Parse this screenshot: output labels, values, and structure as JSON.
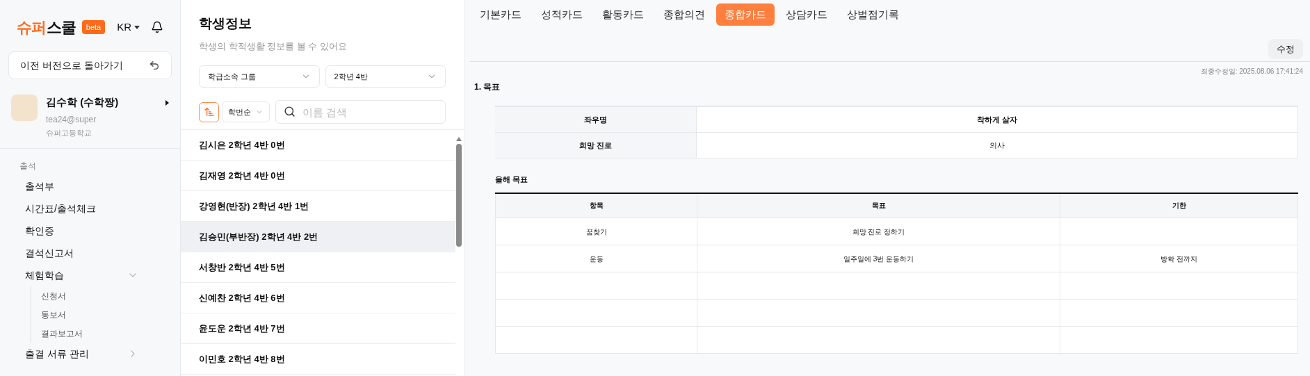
{
  "sidebar": {
    "logo": "슈퍼스쿨",
    "badge": "beta",
    "language": "KR",
    "back_button": "이전 버전으로 돌아가기",
    "profile": {
      "name": "김수학 (수학짱)",
      "email": "tea24@super",
      "school": "슈퍼고등학교"
    },
    "section": "출석",
    "items": [
      {
        "label": "출석부"
      },
      {
        "label": "시간표/출석체크"
      },
      {
        "label": "확인증"
      },
      {
        "label": "결석신고서"
      },
      {
        "label": "체험학습",
        "expanded": true,
        "children": [
          {
            "label": "신청서"
          },
          {
            "label": "통보서"
          },
          {
            "label": "결과보고서"
          }
        ]
      },
      {
        "label": "출결 서류 관리",
        "expanded": false
      }
    ]
  },
  "student_panel": {
    "title": "학생정보",
    "subtitle": "학생의 학적생활 정보를 볼 수 있어요",
    "group_select": "학급소속 그룹",
    "class_select": "2학년 4반",
    "sort_select": "학번순",
    "search": {
      "placeholder": "이름 검색"
    },
    "students": [
      {
        "label": "김시은 2학년 4반 0번",
        "selected": false
      },
      {
        "label": "김재영 2학년 4반 0번",
        "selected": false
      },
      {
        "label": "강영현(반장) 2학년 4반 1번",
        "selected": false
      },
      {
        "label": "김승민(부반장) 2학년 4반 2번",
        "selected": true
      },
      {
        "label": "서창반 2학년 4반 5번",
        "selected": false
      },
      {
        "label": "신예찬 2학년 4반 6번",
        "selected": false
      },
      {
        "label": "윤도운 2학년 4반 7번",
        "selected": false
      },
      {
        "label": "이민호 2학년 4반 8번",
        "selected": false
      }
    ]
  },
  "tabs": [
    {
      "label": "기본카드",
      "selected": false
    },
    {
      "label": "성적카드",
      "selected": false
    },
    {
      "label": "활동카드",
      "selected": false
    },
    {
      "label": "종합의견",
      "selected": false
    },
    {
      "label": "종합카드",
      "selected": true
    },
    {
      "label": "상담카드",
      "selected": false
    },
    {
      "label": "상벌점기록",
      "selected": false
    }
  ],
  "edit_button": "수정",
  "last_modified": "최종수정일: 2025.08.06 17:41:24",
  "section_title": "1. 목표",
  "profile_table": [
    {
      "label": "좌우명",
      "value": "착하게 살자",
      "bold": true
    },
    {
      "label": "희망 진로",
      "value": "의사",
      "bold": false
    }
  ],
  "goals_title": "올해 목표",
  "goals_table": {
    "columns": [
      "항목",
      "목표",
      "기한"
    ],
    "rows": [
      {
        "item": "꿈찾기",
        "goal": "희망 진로 정하기"
      },
      {
        "item": "운동",
        "goal": "일주일에 3번 운동하기",
        "deadline": "방학 전까지"
      }
    ]
  }
}
